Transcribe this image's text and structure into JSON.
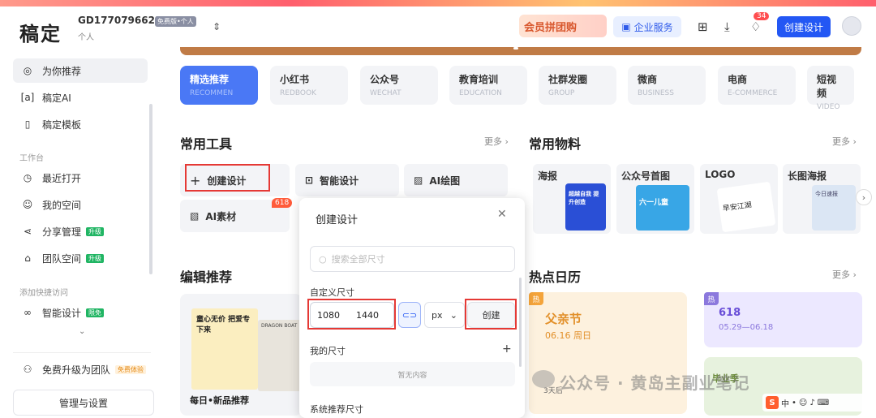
{
  "header": {
    "logo": "稿定",
    "account_id": "GD1770796621",
    "account_badge": "免费版•个人",
    "account_sub": "个人",
    "promo": "会员拼团购",
    "enterprise": "企业服务",
    "notification_count": "34",
    "create_design": "创建设计"
  },
  "sidebar": {
    "items": [
      {
        "label": "为你推荐",
        "icon": "compass-icon"
      },
      {
        "label": "稿定AI",
        "icon": "ai-icon"
      },
      {
        "label": "稿定模板",
        "icon": "template-icon"
      }
    ],
    "workspace_title": "工作台",
    "workspace_items": [
      {
        "label": "最近打开",
        "icon": "clock-icon"
      },
      {
        "label": "我的空间",
        "icon": "user-icon"
      },
      {
        "label": "分享管理",
        "icon": "share-icon",
        "tag": "升级"
      },
      {
        "label": "团队空间",
        "icon": "team-icon",
        "tag": "升级"
      }
    ],
    "quick_title": "添加快捷访问",
    "quick_items": [
      {
        "label": "智能设计",
        "icon": "infinity-icon",
        "tag": "限免"
      }
    ],
    "upgrade": {
      "label": "免费升级为团队",
      "tag": "免费体验"
    },
    "manage": "管理与设置"
  },
  "categories": [
    {
      "cn": "精选推荐",
      "en": "RECOMMEN"
    },
    {
      "cn": "小红书",
      "en": "REDBOOK"
    },
    {
      "cn": "公众号",
      "en": "WECHAT"
    },
    {
      "cn": "教育培训",
      "en": "EDUCATION"
    },
    {
      "cn": "社群发圈",
      "en": "GROUP"
    },
    {
      "cn": "微商",
      "en": "BUSINESS"
    },
    {
      "cn": "电商",
      "en": "E-COMMERCE"
    },
    {
      "cn": "短视频",
      "en": "VIDEO"
    }
  ],
  "tools": {
    "title": "常用工具",
    "more": "更多 ›",
    "items": [
      "创建设计",
      "智能设计",
      "AI绘图",
      "AI素材"
    ],
    "badge": "618"
  },
  "materials": {
    "title": "常用物料",
    "more": "更多 ›",
    "items": [
      "海报",
      "公众号首图",
      "LOGO",
      "长图海报"
    ],
    "thumb_texts": [
      "超越自我 提升创造",
      "六一儿童",
      "早安江湖",
      "今日速报"
    ]
  },
  "editor": {
    "title": "编辑推荐",
    "card_label": "每日•新品推荐",
    "poster_text": "童心无价 把爱专下来",
    "poster2_text": "DRAGON BOAT"
  },
  "hot": {
    "title": "热点日历",
    "more": "更多 ›",
    "tag": "热",
    "card1": {
      "title": "父亲节",
      "date": "06.16 周日",
      "sub": "3天后"
    },
    "card2": {
      "title": "618",
      "date": "05.29—06.18"
    },
    "card3": {
      "title": "毕业季"
    }
  },
  "modal": {
    "title": "创建设计",
    "search_placeholder": "搜索全部尺寸",
    "custom_label": "自定义尺寸",
    "width": "1080",
    "height": "1440",
    "unit": "px",
    "create": "创建",
    "my_sizes": "我的尺寸",
    "empty": "暂无内容",
    "system_sizes": "系统推荐尺寸"
  },
  "watermark": "公众号 · 黄岛主副业笔记",
  "ime": {
    "s": "S",
    "items": [
      "中",
      "•",
      "☺",
      "♪",
      "⌨"
    ]
  },
  "colors": {
    "primary": "#2357f4",
    "highlight": "#e53935",
    "hot": "#f4a43b"
  }
}
